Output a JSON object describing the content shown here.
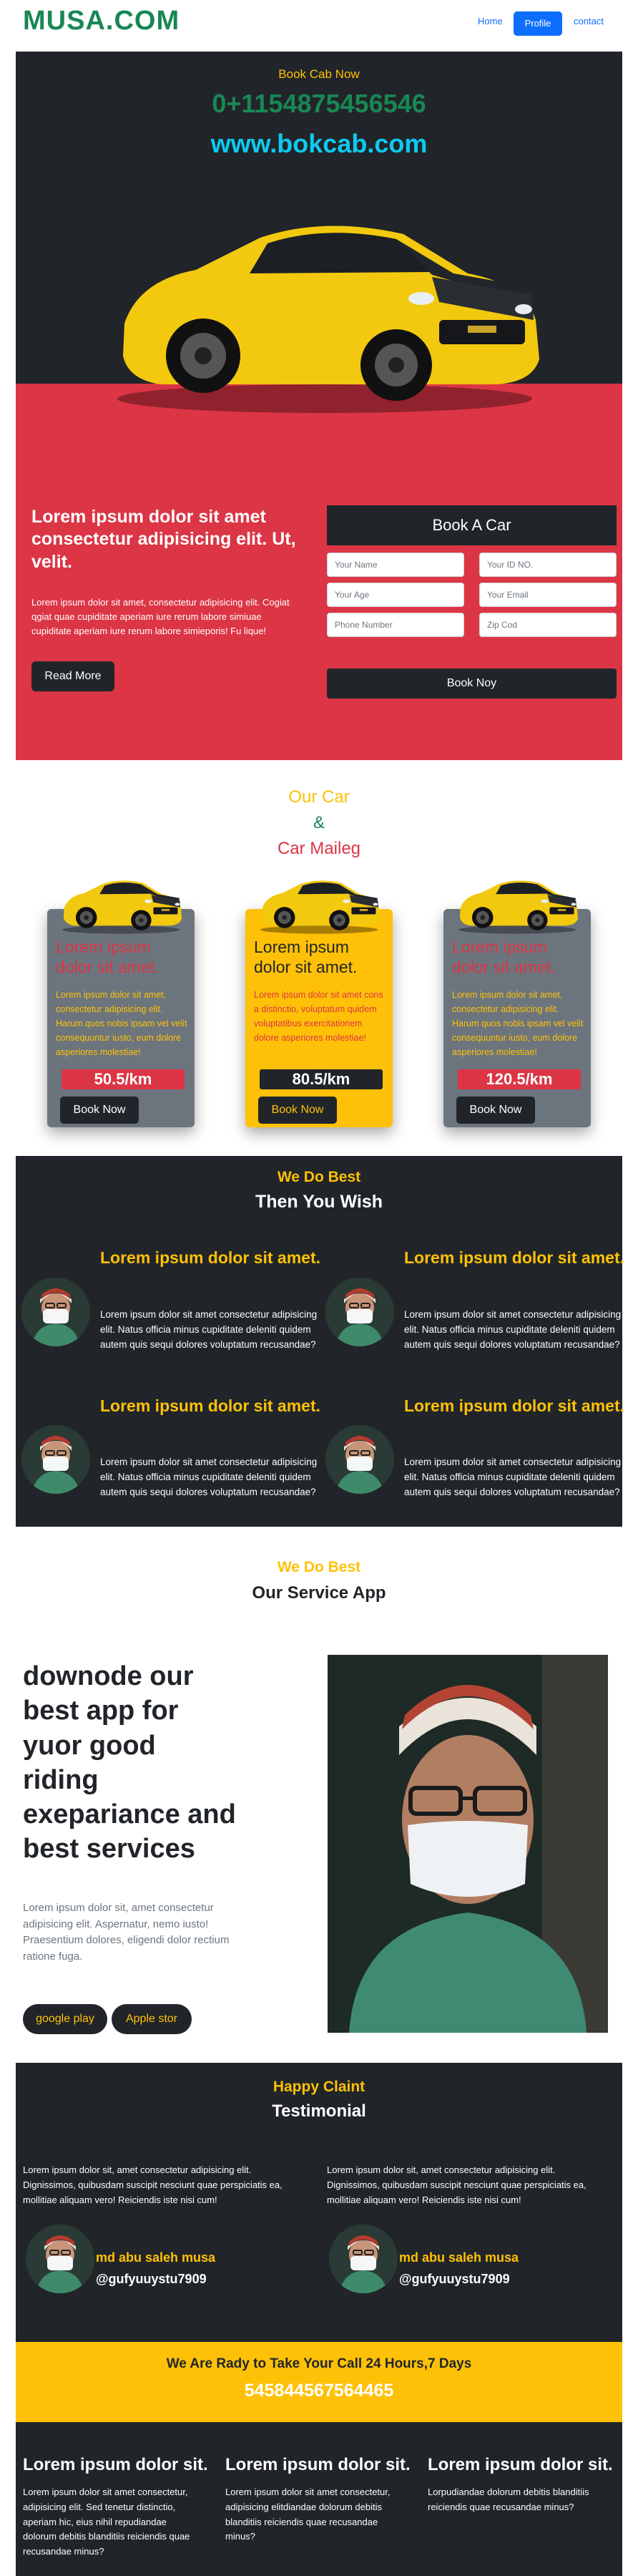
{
  "nav": {
    "brand": "MUSA.COM",
    "home": "Home",
    "profile": "Profile",
    "contact": "contact"
  },
  "hero": {
    "subtitle": "Book Cab Now",
    "phone": "0+1154875456546",
    "website": "www.bokcab.com",
    "heading": "Lorem ipsum dolor sit amet consectetur adipisicing elit. Ut, velit.",
    "paragraph": "Lorem ipsum dolor sit amet, consectetur adipisicing elit. Cogiat qgiat quae cupiditate aperiam iure rerum labore simiuae cupiditate aperiam iure rerum labore simieporis! Fu lique!",
    "read_more": "Read More"
  },
  "booking": {
    "title": "Book A Car",
    "fields": {
      "name": "Your Name",
      "id": "Your ID NO.",
      "age": "Your Age",
      "email": "Your Email",
      "phone": "Phone Number",
      "zip": "Zip Cod"
    },
    "submit": "Book Noy"
  },
  "cars": {
    "title1": "Our Car",
    "amp": "&",
    "title2": "Car Maileg",
    "cards": [
      {
        "heading": "Lorem ipsum dolor sit amet.",
        "text": "Lorem ipsum dolor sit amet, consectetur adipisicing elit. Harum quos nobis ipsam vel velit consequuntur iusto, eum dolore asperiores molestiae!",
        "price": "50.5/km",
        "button": "Book Now"
      },
      {
        "heading": "Lorem ipsum dolor sit amet.",
        "text": "Lorem ipsum dolor sit amet cons a distinctio, voluptatum quidem voluptatibus exercitationem dolore asperiores molestiae!",
        "price": "80.5/km",
        "button": "Book Now"
      },
      {
        "heading": "Lorem ipsum dolor sit amet.",
        "text": "Lorem ipsum dolor sit amet, consectetur adipisicing elit. Harum quos nobis ipsam vel velit consequuntur iusto, eum dolore asperiores molestiae!",
        "price": "120.5/km",
        "button": "Book Now"
      }
    ]
  },
  "wdb": {
    "kicker": "We Do Best",
    "title": "Then You Wish",
    "items": [
      {
        "heading": "Lorem ipsum dolor sit amet.",
        "text": "Lorem ipsum dolor sit amet consectetur adipisicing elit. Natus officia minus cupiditate deleniti quidem autem quis sequi dolores voluptatum recusandae?"
      },
      {
        "heading": "Lorem ipsum dolor sit amet.",
        "text": "Lorem ipsum dolor sit amet consectetur adipisicing elit. Natus officia minus cupiditate deleniti quidem autem quis sequi dolores voluptatum recusandae?"
      },
      {
        "heading": "Lorem ipsum dolor sit amet.",
        "text": "Lorem ipsum dolor sit amet consectetur adipisicing elit. Natus officia minus cupiditate deleniti quidem autem quis sequi dolores voluptatum recusandae?"
      },
      {
        "heading": "Lorem ipsum dolor sit amet.",
        "text": "Lorem ipsum dolor sit amet consectetur adipisicing elit. Natus officia minus cupiditate deleniti quidem autem quis sequi dolores voluptatum recusandae?"
      }
    ]
  },
  "service": {
    "kicker": "We Do Best",
    "title": "Our Service App",
    "heading": "downode our best app for yuor good riding exepariance and best services",
    "paragraph": "Lorem ipsum dolor sit, amet consectetur adipisicing elit. Aspernatur, nemo iusto! Praesentium dolores, eligendi dolor rectium ratione fuga.",
    "google_play": "google play",
    "apple_store": "Apple stor"
  },
  "testimonial": {
    "kicker": "Happy Claint",
    "title": "Testimonial",
    "items": [
      {
        "text": "Lorem ipsum dolor sit, amet consectetur adipisicing elit. Dignissimos, quibusdam suscipit nesciunt quae perspiciatis ea, mollitiae aliquam vero! Reiciendis iste nisi cum!",
        "name": "md abu saleh musa",
        "handle": "@gufyuuystu7909"
      },
      {
        "text": "Lorem ipsum dolor sit, amet consectetur adipisicing elit. Dignissimos, quibusdam suscipit nesciunt quae perspiciatis ea, mollitiae aliquam vero! Reiciendis iste nisi cum!",
        "name": "md abu saleh musa",
        "handle": "@gufyuuystu7909"
      }
    ]
  },
  "cta": {
    "text": "We Are Rady to Take Your Call 24 Hours,7 Days",
    "phone": "545844567564465"
  },
  "footer": {
    "cols": [
      {
        "heading": "Lorem ipsum dolor sit.",
        "text": "Lorem ipsum dolor sit amet consectetur, adipisicing elit. Sed tenetur distinctio, aperiam hic, eius nihil repudiandae dolorum debitis blanditiis reiciendis quae recusandae minus?"
      },
      {
        "heading": "Lorem ipsum dolor sit.",
        "text": "Lorem ipsum dolor sit amet consectetur, adipisicing elitdiandae dolorum debitis blanditiis reiciendis quae recusandae minus?"
      },
      {
        "heading": "Lorem ipsum dolor sit.",
        "text": "Lorpudiandae dolorum debitis blanditiis reiciendis quae recusandae minus?"
      }
    ]
  },
  "colors": {
    "dark": "#212529",
    "red": "#dc3545",
    "yellow": "#ffc107",
    "green": "#198754",
    "cyan": "#0dcaf0",
    "blue": "#0d6efd",
    "gray_card": "#6c757d"
  }
}
